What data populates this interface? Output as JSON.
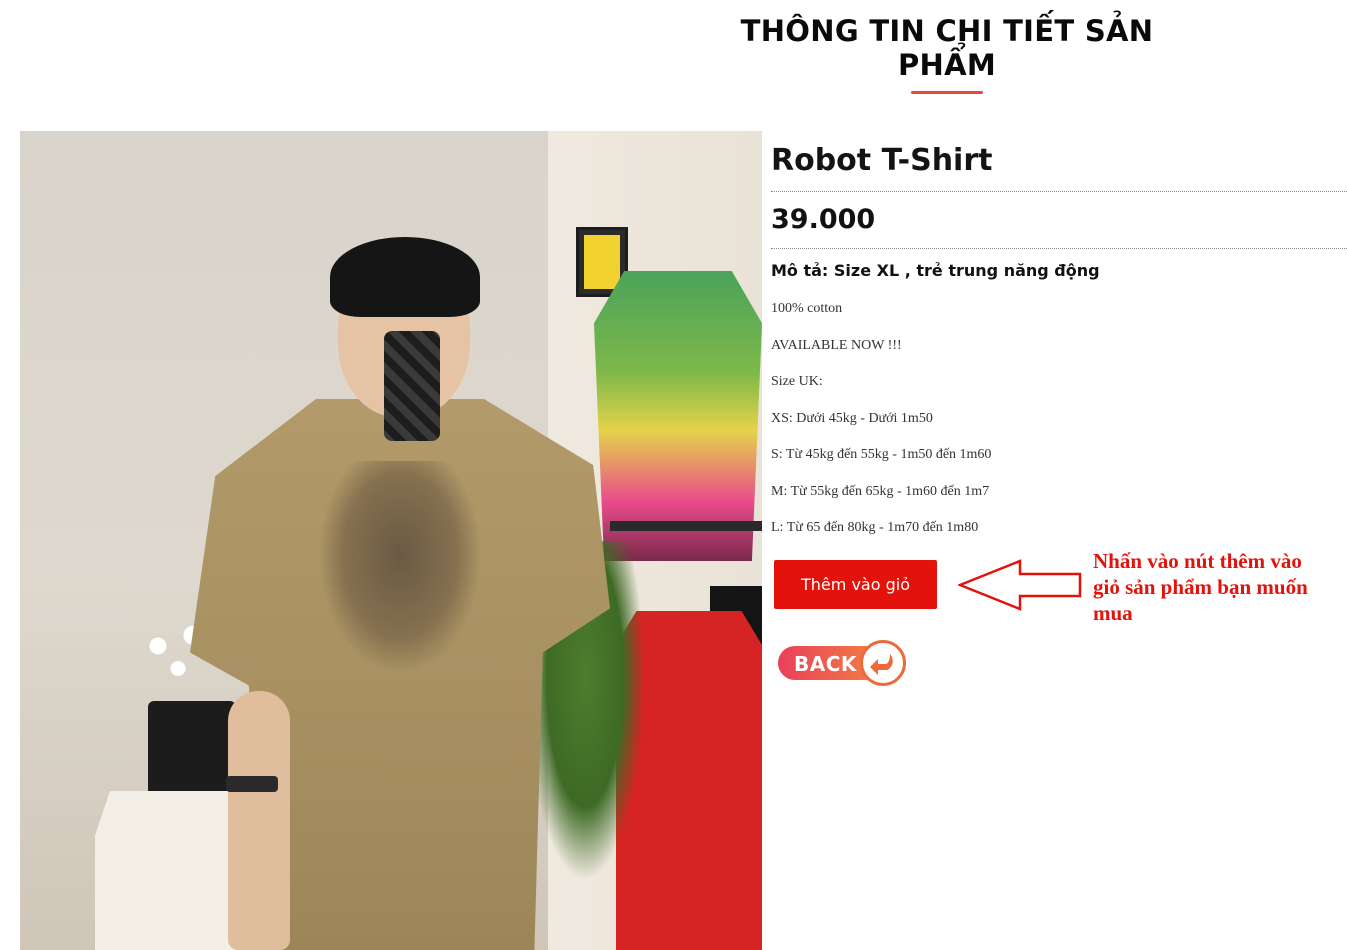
{
  "page": {
    "heading": "THÔNG TIN CHI TIẾT SẢN PHẨM"
  },
  "product": {
    "title": "Robot T-Shirt",
    "price": "39.000",
    "description_label": "Mô tả: Size XL , trẻ trung năng động",
    "description_lines": [
      "100% cotton",
      "AVAILABLE NOW !!!",
      "Size UK:",
      "XS: Dưới 45kg - Dưới 1m50",
      "S: Từ 45kg đến 55kg - 1m50 đến 1m60",
      "M: Từ 55kg đến 65kg - 1m60 đến 1m7",
      "L: Từ 65 đến 80kg - 1m70 đến 1m80"
    ]
  },
  "actions": {
    "add_to_cart_label": "Thêm vào giỏ",
    "back_label": "BACK"
  },
  "annotation": {
    "hint_text": "Nhấn vào nút thêm vào giỏ sản phẩm bạn muốn mua",
    "arrow_direction": "left"
  },
  "colors": {
    "accent_red": "#e3120b",
    "heading_underline": "#e8473b",
    "back_gradient_start": "#e9405a",
    "back_gradient_end": "#f27d43"
  },
  "icons": {
    "back": "return-arrow-icon",
    "hint_arrow": "arrow-left-outline-icon"
  }
}
